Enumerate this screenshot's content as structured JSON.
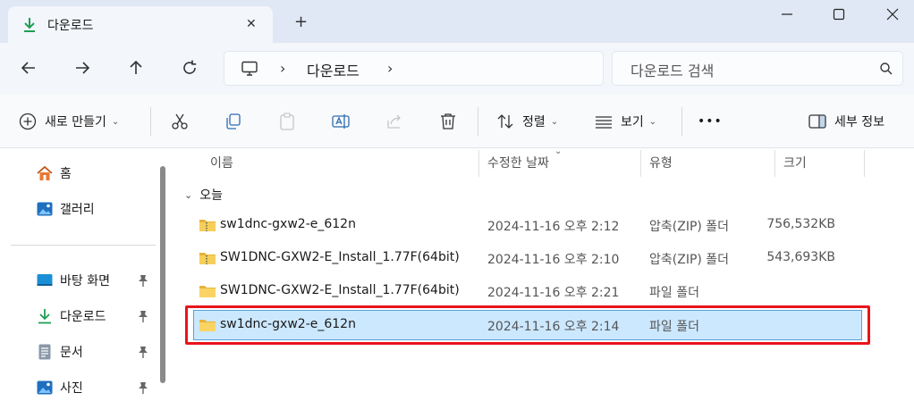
{
  "tab": {
    "title": "다운로드",
    "close": "✕",
    "new_tab": "+"
  },
  "address": {
    "separator": "›",
    "current": "다운로드",
    "search_placeholder": "다운로드 검색"
  },
  "toolbar": {
    "new_label": "새로 만들기",
    "sort_label": "정렬",
    "view_label": "보기",
    "more_label": "•••",
    "details_label": "세부 정보"
  },
  "sidebar": {
    "items": [
      {
        "label": "홈",
        "icon": "home-icon"
      },
      {
        "label": "갤러리",
        "icon": "gallery-icon"
      },
      {
        "label": "바탕 화면",
        "icon": "desktop-icon",
        "pinned": true
      },
      {
        "label": "다운로드",
        "icon": "download-icon",
        "pinned": true
      },
      {
        "label": "문서",
        "icon": "document-icon",
        "pinned": true
      },
      {
        "label": "사진",
        "icon": "pictures-icon",
        "pinned": true
      }
    ]
  },
  "columns": {
    "name": "이름",
    "date": "수정한 날짜",
    "type": "유형",
    "size": "크기"
  },
  "group": {
    "label": "오늘"
  },
  "files": [
    {
      "name": "sw1dnc-gxw2-e_612n",
      "date": "2024-11-16 오후 2:12",
      "type": "압축(ZIP) 폴더",
      "size": "756,532KB",
      "icon": "zip-folder-icon"
    },
    {
      "name": "SW1DNC-GXW2-E_Install_1.77F(64bit)",
      "date": "2024-11-16 오후 2:10",
      "type": "압축(ZIP) 폴더",
      "size": "543,693KB",
      "icon": "zip-folder-icon"
    },
    {
      "name": "SW1DNC-GXW2-E_Install_1.77F(64bit)",
      "date": "2024-11-16 오후 2:21",
      "type": "파일 폴더",
      "size": "",
      "icon": "folder-icon"
    },
    {
      "name": "sw1dnc-gxw2-e_612n",
      "date": "2024-11-16 오후 2:14",
      "type": "파일 폴더",
      "size": "",
      "icon": "folder-icon",
      "selected": true
    }
  ],
  "colors": {
    "accent": "#0f7b3c",
    "selection": "#cce8ff",
    "highlight": "#e8141c"
  }
}
